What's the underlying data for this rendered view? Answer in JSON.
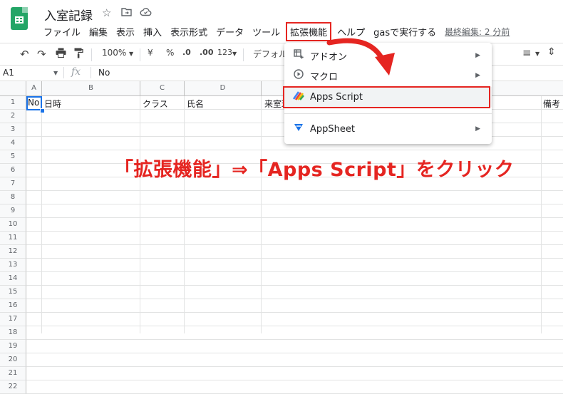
{
  "doc": {
    "title": "入室記録",
    "last_edit": "最終編集: 2 分前"
  },
  "menu": [
    "ファイル",
    "編集",
    "表示",
    "挿入",
    "表示形式",
    "データ",
    "ツール",
    "拡張機能",
    "ヘルプ",
    "gasで実行する"
  ],
  "toolbar": {
    "zoom": "100%",
    "currency": "¥",
    "percent": "%",
    "dec_less": ".0",
    "dec_more": ".00",
    "more_formats": "123",
    "font": "デフォルト"
  },
  "formula_bar": {
    "cell_ref": "A1",
    "fx": "fx",
    "value": "No"
  },
  "columns": [
    "A",
    "B",
    "C",
    "D"
  ],
  "rows": [
    "1",
    "2",
    "3",
    "4",
    "5",
    "6",
    "7",
    "8",
    "9",
    "10",
    "11",
    "12",
    "13",
    "14",
    "15",
    "16",
    "17",
    "18",
    "19",
    "20",
    "21",
    "22"
  ],
  "row1": {
    "a": "No",
    "b": "日時",
    "c": "クラス",
    "d": "氏名",
    "e": "来室理",
    "last": "備考"
  },
  "dropdown": {
    "items": [
      {
        "label": "アドオン",
        "icon": "add-on-icon",
        "submenu": true
      },
      {
        "label": "マクロ",
        "icon": "macro-play-icon",
        "submenu": true
      },
      {
        "label": "Apps Script",
        "icon": "apps-script-icon",
        "submenu": false
      },
      {
        "label": "AppSheet",
        "icon": "appsheet-icon",
        "submenu": true
      }
    ]
  },
  "instruction": "「拡張機能」⇒「Apps Script」をクリック",
  "colors": {
    "highlight": "#e52521",
    "sheets_green": "#23a566",
    "selection": "#1a73e8"
  }
}
